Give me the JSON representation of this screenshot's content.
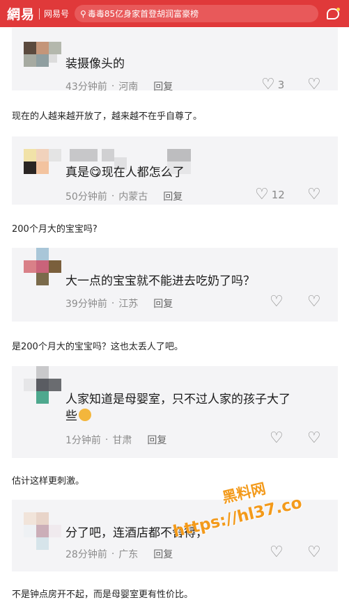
{
  "header": {
    "logo": "網易",
    "channel": "网易号",
    "search_text": "毒毒85亿身家首登胡润富豪榜",
    "search_icon": "search-icon",
    "message_icon": "message-icon"
  },
  "comments": [
    {
      "text": "装摄像头的",
      "time": "43分钟前",
      "location": "河南",
      "reply_label": "回复",
      "like_count": "3"
    },
    {
      "text": "真是😋现在人都怎么了",
      "time": "50分钟前",
      "location": "内蒙古",
      "reply_label": "回复",
      "like_count": "12"
    },
    {
      "text": "大一点的宝宝就不能进去吃奶了吗？",
      "time": "39分钟前",
      "location": "江苏",
      "reply_label": "回复",
      "like_count": ""
    },
    {
      "text_line1": "人家知道是母婴室，只不过人家的孩子大了",
      "text_line2": "些",
      "time": "1分钟前",
      "location": "甘肃",
      "reply_label": "回复",
      "like_count": ""
    },
    {
      "text": "分了吧，连酒店都不舍得，",
      "time": "28分钟前",
      "location": "广东",
      "reply_label": "回复",
      "like_count": ""
    }
  ],
  "captions": [
    "现在的人越来越开放了，越来越不在乎自尊了。",
    "200个月大的宝宝吗?",
    "是200个月大的宝宝吗？这也太丢人了吧。",
    "估计这样更刺激。",
    "不是钟点房开不起，而是母婴室更有性价比。"
  ],
  "watermark": {
    "line1": "黑料网",
    "line2": "https://hl37.co"
  },
  "colors": {
    "brand_red": "#e0393a",
    "watermark_orange": "#f39a1b"
  }
}
